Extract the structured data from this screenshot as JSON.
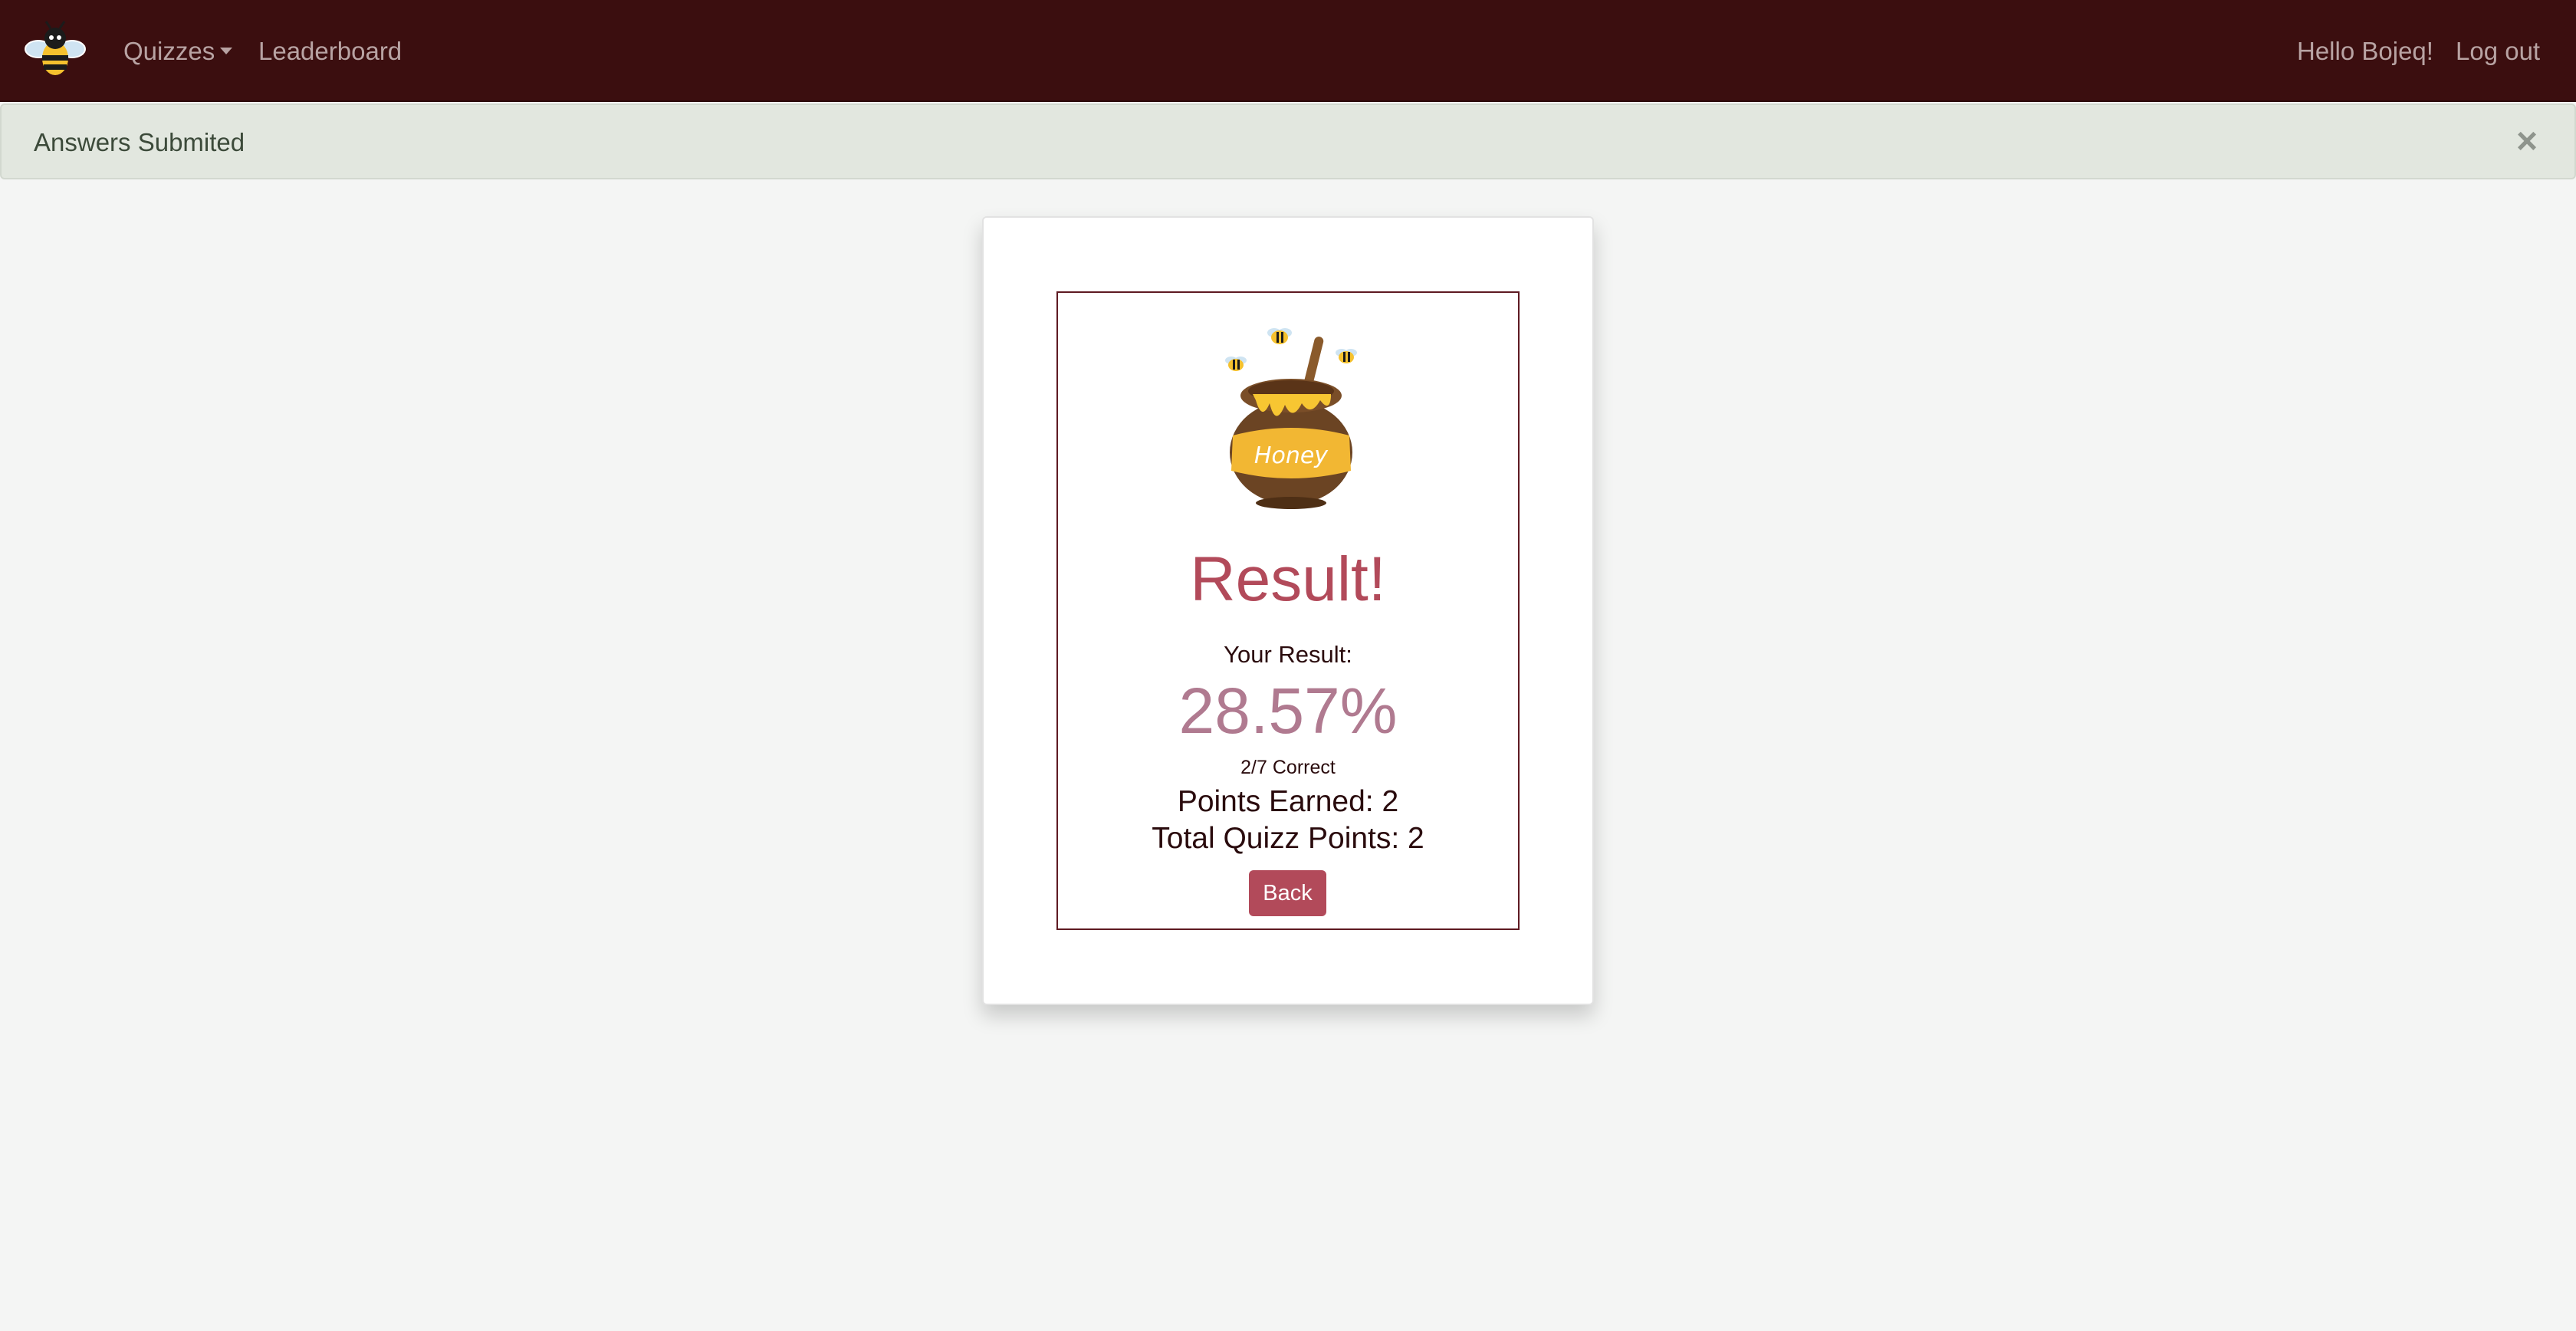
{
  "navbar": {
    "logo": "bee-logo-icon",
    "quizzes_label": "Quizzes",
    "leaderboard_label": "Leaderboard",
    "greeting": "Hello Bojeq!",
    "logout_label": "Log out"
  },
  "alert": {
    "message": "Answers Submited",
    "close_glyph": "×"
  },
  "result": {
    "image": "honey-pot-with-bees-icon",
    "pot_label": "Honey",
    "title": "Result!",
    "your_result_label": "Your Result:",
    "percentage": "28.57%",
    "correct": "2/7 Correct",
    "points_earned": "Points Earned: 2",
    "total_points": "Total Quizz Points: 2",
    "back_label": "Back"
  },
  "colors": {
    "navbar_bg": "#3b0e0f",
    "alert_bg": "#e2e7df",
    "accent": "#b24a5a",
    "percent": "#b07a90",
    "page_bg": "#f4f5f4"
  }
}
